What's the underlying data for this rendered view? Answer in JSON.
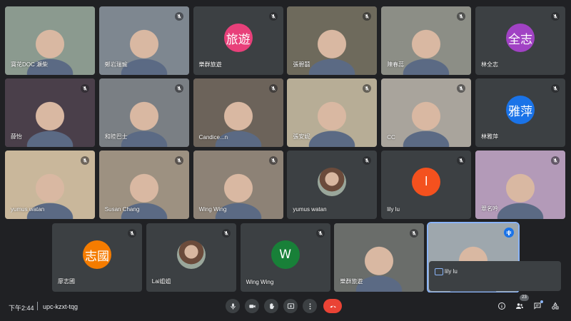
{
  "meeting": {
    "time": "下午2:44",
    "code": "upc-kzxt-tqg",
    "participant_count": "23"
  },
  "colors": {
    "background": "#202124",
    "tile": "#3c4043",
    "end_call": "#ea4335",
    "active_speaker": "#8ab4f8"
  },
  "tiles": [
    {
      "name": "寶花DOC 瀬柴",
      "kind": "video",
      "muted": false,
      "bg": "#8b9a8f"
    },
    {
      "name": "鄭岩瑞瑜",
      "kind": "video",
      "muted": true,
      "bg": "#7e8790"
    },
    {
      "name": "樂群旅遊",
      "kind": "avatar",
      "avatar_text": "旅遊",
      "avatar_color": "#e8407a",
      "muted": true
    },
    {
      "name": "張碧囍",
      "kind": "video",
      "muted": true,
      "bg": "#6e6a5c"
    },
    {
      "name": "陳春蕊",
      "kind": "video",
      "muted": true,
      "bg": "#8c8e86"
    },
    {
      "name": "林全志",
      "kind": "avatar",
      "avatar_text": "全志",
      "avatar_color": "#a142c4",
      "muted": true
    },
    {
      "name": "薛怡",
      "kind": "video",
      "muted": true,
      "bg": "#4a3f4a"
    },
    {
      "name": "和睦巴士",
      "kind": "video",
      "muted": true,
      "bg": "#7a7f84"
    },
    {
      "name": "Candice...n",
      "kind": "video",
      "muted": true,
      "bg": "#6c635a"
    },
    {
      "name": "張安妮",
      "kind": "video",
      "muted": true,
      "bg": "#b7ad96"
    },
    {
      "name": "CC",
      "kind": "video",
      "muted": true,
      "bg": "#a9a49c"
    },
    {
      "name": "林雅萍",
      "kind": "avatar",
      "avatar_text": "雅萍",
      "avatar_color": "#1a73e8",
      "muted": true
    },
    {
      "name": "yumus watan",
      "kind": "video",
      "muted": true,
      "bg": "#c9b79b"
    },
    {
      "name": "Susan Chang",
      "kind": "video",
      "muted": true,
      "bg": "#9d9181"
    },
    {
      "name": "Wing Wing",
      "kind": "video",
      "muted": true,
      "bg": "#8d8276"
    },
    {
      "name": "yumus watan",
      "kind": "photo",
      "muted": true
    },
    {
      "name": "lily lu",
      "kind": "avatar",
      "avatar_text": "l",
      "avatar_color": "#f4511e",
      "muted": true
    },
    {
      "name": "翠名吟",
      "kind": "video",
      "muted": true,
      "bg": "#b39ab8"
    },
    {
      "name": "廖志國",
      "kind": "avatar",
      "avatar_text": "志國",
      "avatar_color": "#f57c00",
      "muted": true
    },
    {
      "name": "Lai姐姐",
      "kind": "photo",
      "muted": true
    },
    {
      "name": "Wing Wing",
      "kind": "avatar",
      "avatar_text": "W",
      "avatar_color": "#188038",
      "muted": true
    },
    {
      "name": "樂群旅遊",
      "kind": "video",
      "muted": true,
      "bg": "#6a6d6a"
    },
    {
      "name": "",
      "kind": "video",
      "muted": false,
      "active": true,
      "bg": "#9ea7ad"
    }
  ],
  "chat_preview": {
    "name": "lily lu"
  },
  "controls": {
    "mic": "microphone-icon",
    "camera": "camera-icon",
    "hand": "raise-hand-icon",
    "present": "present-screen-icon",
    "more": "more-options-icon",
    "end": "end-call-icon"
  },
  "right_controls": {
    "info": "info-icon",
    "people": "people-icon",
    "chat": "chat-icon",
    "activities": "activities-icon"
  }
}
